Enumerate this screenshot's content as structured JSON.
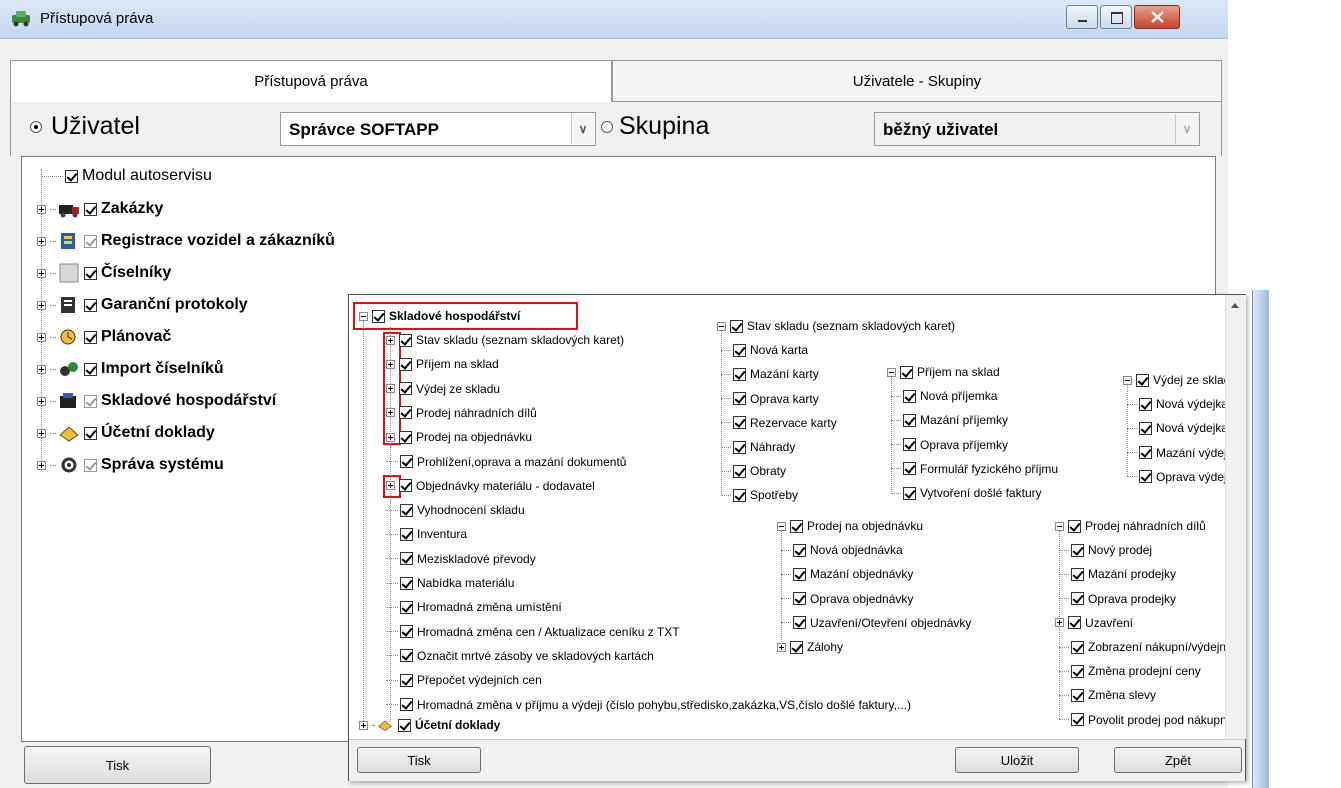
{
  "window": {
    "title": "Přístupová práva"
  },
  "tabs": [
    {
      "label": "Přístupová práva"
    },
    {
      "label": "Uživatele - Skupiny"
    }
  ],
  "selector": {
    "user_label": "Uživatel",
    "user_value": "Správce SOFTAPP",
    "group_label": "Skupina",
    "group_value": "běžný uživatel"
  },
  "tree": {
    "root": "Modul autoservisu",
    "items": [
      {
        "label": "Zakázky"
      },
      {
        "label": "Registrace vozidel a zákazníků"
      },
      {
        "label": "Číselníky"
      },
      {
        "label": "Garanční protokoly"
      },
      {
        "label": "Plánovač"
      },
      {
        "label": "Import číselníků"
      },
      {
        "label": "Skladové hospodářství"
      },
      {
        "label": "Účetní doklady"
      },
      {
        "label": "Správa systému"
      }
    ]
  },
  "main_buttons": {
    "print": "Tisk"
  },
  "popup": {
    "root": "Skladové hospodářství",
    "left_items": [
      "Stav skladu (seznam skladových karet)",
      "Příjem na sklad",
      "Výdej ze skladu",
      "Prodej náhradních dílů",
      "Prodej na objednávku",
      "Prohlížení,oprava a mazání dokumentů",
      "Objednávky materiálu - dodavatel",
      "Vyhodnocení skladu",
      "Inventura",
      "Meziskladové převody",
      "Nabídka materiálu",
      "Hromadná změna umístění",
      "Hromadná změna cen / Aktualizace ceníku z TXT",
      "Označit mrtvé zásoby ve skladových kartách",
      "Přepočet výdejních cen",
      "Hromadná změna v příjmu a výdeji (číslo pohybu,středisko,zakázka,VS,číslo došlé faktury,...)"
    ],
    "ucetni": "Účetní doklady",
    "stav_skladu": {
      "title": "Stav skladu (seznam skladových karet)",
      "items": [
        "Nová karta",
        "Mazání karty",
        "Oprava karty",
        "Rezervace karty",
        "Náhrady",
        "Obraty",
        "Spotřeby"
      ]
    },
    "prijem": {
      "title": "Příjem na sklad",
      "items": [
        "Nová příjemka",
        "Mazání příjemky",
        "Oprava příjemky",
        "Formulář fyzického příjmu",
        "Vytvoření došlé faktury"
      ]
    },
    "vydej": {
      "title": "Výdej ze skladu",
      "items": [
        "Nová výdejka ze skladu",
        "Nová výdejka ze servisu",
        "Mazání výdejky",
        "Oprava výdejky"
      ]
    },
    "prodej_obj": {
      "title": "Prodej na objednávku",
      "items": [
        "Nová objednávka",
        "Mazání objednávky",
        "Oprava objednávky",
        "Uzavření/Otevření objednávky",
        "Zálohy"
      ]
    },
    "prodej_nd": {
      "title": "Prodej náhradních dílů",
      "items": [
        "Nový prodej",
        "Mazání prodejky",
        "Oprava prodejky",
        "Uzavření",
        "Zobrazení nákupní/výdejní ceny",
        "Změna prodejní ceny",
        "Změna slevy",
        "Povolit prodej pod nákupní ceny"
      ]
    },
    "buttons": {
      "print": "Tisk",
      "save": "Uložit",
      "back": "Zpět"
    }
  }
}
